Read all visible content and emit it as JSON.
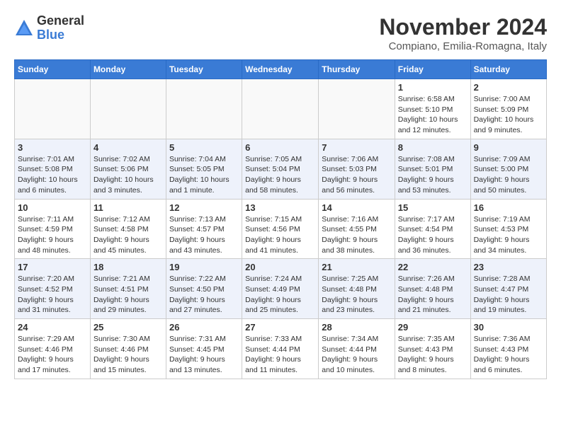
{
  "header": {
    "logo": {
      "general": "General",
      "blue": "Blue"
    },
    "month": "November 2024",
    "location": "Compiano, Emilia-Romagna, Italy"
  },
  "weekdays": [
    "Sunday",
    "Monday",
    "Tuesday",
    "Wednesday",
    "Thursday",
    "Friday",
    "Saturday"
  ],
  "weeks": [
    [
      {
        "day": "",
        "info": ""
      },
      {
        "day": "",
        "info": ""
      },
      {
        "day": "",
        "info": ""
      },
      {
        "day": "",
        "info": ""
      },
      {
        "day": "",
        "info": ""
      },
      {
        "day": "1",
        "info": "Sunrise: 6:58 AM\nSunset: 5:10 PM\nDaylight: 10 hours and 12 minutes."
      },
      {
        "day": "2",
        "info": "Sunrise: 7:00 AM\nSunset: 5:09 PM\nDaylight: 10 hours and 9 minutes."
      }
    ],
    [
      {
        "day": "3",
        "info": "Sunrise: 7:01 AM\nSunset: 5:08 PM\nDaylight: 10 hours and 6 minutes."
      },
      {
        "day": "4",
        "info": "Sunrise: 7:02 AM\nSunset: 5:06 PM\nDaylight: 10 hours and 3 minutes."
      },
      {
        "day": "5",
        "info": "Sunrise: 7:04 AM\nSunset: 5:05 PM\nDaylight: 10 hours and 1 minute."
      },
      {
        "day": "6",
        "info": "Sunrise: 7:05 AM\nSunset: 5:04 PM\nDaylight: 9 hours and 58 minutes."
      },
      {
        "day": "7",
        "info": "Sunrise: 7:06 AM\nSunset: 5:03 PM\nDaylight: 9 hours and 56 minutes."
      },
      {
        "day": "8",
        "info": "Sunrise: 7:08 AM\nSunset: 5:01 PM\nDaylight: 9 hours and 53 minutes."
      },
      {
        "day": "9",
        "info": "Sunrise: 7:09 AM\nSunset: 5:00 PM\nDaylight: 9 hours and 50 minutes."
      }
    ],
    [
      {
        "day": "10",
        "info": "Sunrise: 7:11 AM\nSunset: 4:59 PM\nDaylight: 9 hours and 48 minutes."
      },
      {
        "day": "11",
        "info": "Sunrise: 7:12 AM\nSunset: 4:58 PM\nDaylight: 9 hours and 45 minutes."
      },
      {
        "day": "12",
        "info": "Sunrise: 7:13 AM\nSunset: 4:57 PM\nDaylight: 9 hours and 43 minutes."
      },
      {
        "day": "13",
        "info": "Sunrise: 7:15 AM\nSunset: 4:56 PM\nDaylight: 9 hours and 41 minutes."
      },
      {
        "day": "14",
        "info": "Sunrise: 7:16 AM\nSunset: 4:55 PM\nDaylight: 9 hours and 38 minutes."
      },
      {
        "day": "15",
        "info": "Sunrise: 7:17 AM\nSunset: 4:54 PM\nDaylight: 9 hours and 36 minutes."
      },
      {
        "day": "16",
        "info": "Sunrise: 7:19 AM\nSunset: 4:53 PM\nDaylight: 9 hours and 34 minutes."
      }
    ],
    [
      {
        "day": "17",
        "info": "Sunrise: 7:20 AM\nSunset: 4:52 PM\nDaylight: 9 hours and 31 minutes."
      },
      {
        "day": "18",
        "info": "Sunrise: 7:21 AM\nSunset: 4:51 PM\nDaylight: 9 hours and 29 minutes."
      },
      {
        "day": "19",
        "info": "Sunrise: 7:22 AM\nSunset: 4:50 PM\nDaylight: 9 hours and 27 minutes."
      },
      {
        "day": "20",
        "info": "Sunrise: 7:24 AM\nSunset: 4:49 PM\nDaylight: 9 hours and 25 minutes."
      },
      {
        "day": "21",
        "info": "Sunrise: 7:25 AM\nSunset: 4:48 PM\nDaylight: 9 hours and 23 minutes."
      },
      {
        "day": "22",
        "info": "Sunrise: 7:26 AM\nSunset: 4:48 PM\nDaylight: 9 hours and 21 minutes."
      },
      {
        "day": "23",
        "info": "Sunrise: 7:28 AM\nSunset: 4:47 PM\nDaylight: 9 hours and 19 minutes."
      }
    ],
    [
      {
        "day": "24",
        "info": "Sunrise: 7:29 AM\nSunset: 4:46 PM\nDaylight: 9 hours and 17 minutes."
      },
      {
        "day": "25",
        "info": "Sunrise: 7:30 AM\nSunset: 4:46 PM\nDaylight: 9 hours and 15 minutes."
      },
      {
        "day": "26",
        "info": "Sunrise: 7:31 AM\nSunset: 4:45 PM\nDaylight: 9 hours and 13 minutes."
      },
      {
        "day": "27",
        "info": "Sunrise: 7:33 AM\nSunset: 4:44 PM\nDaylight: 9 hours and 11 minutes."
      },
      {
        "day": "28",
        "info": "Sunrise: 7:34 AM\nSunset: 4:44 PM\nDaylight: 9 hours and 10 minutes."
      },
      {
        "day": "29",
        "info": "Sunrise: 7:35 AM\nSunset: 4:43 PM\nDaylight: 9 hours and 8 minutes."
      },
      {
        "day": "30",
        "info": "Sunrise: 7:36 AM\nSunset: 4:43 PM\nDaylight: 9 hours and 6 minutes."
      }
    ]
  ]
}
